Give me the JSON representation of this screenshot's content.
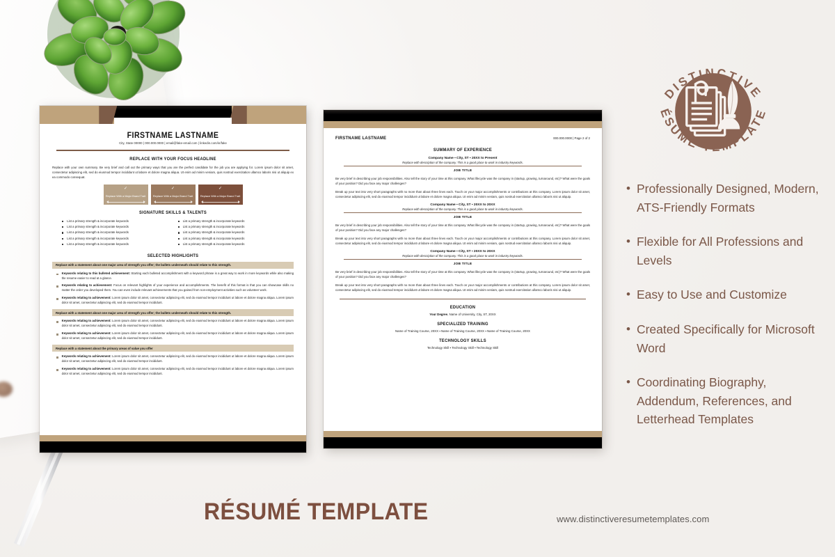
{
  "brand": {
    "logo_top_text": "DISTINCTIVE",
    "logo_bottom_text": "RÉSUMÉ TEMPLATES",
    "accent_brown": "#7d5c48",
    "accent_tan": "#bfa37c",
    "title_color": "#7d4f3f"
  },
  "footer": {
    "title": "RÉSUMÉ TEMPLATE",
    "website": "www.distinctiveresumetemplates.com"
  },
  "features": {
    "bullet": "•",
    "items": [
      "Professionally Designed, Modern, ATS-Friendly Formats",
      "Flexible for All Professions and Levels",
      "Easy to Use and Customize",
      "Created Specifically for Microsoft Word",
      "Coordinating Biography, Addendum, References, and Letterhead Templates"
    ]
  },
  "page1": {
    "name": "FIRSTNAME LASTNAME",
    "contact": "City, State 00000 | 000.000.0000 | email@fake-email.com | linkedin.com/in/fake",
    "headline": "REPLACE WITH YOUR FOCUS HEADLINE",
    "summary": "Replace with your own summary. Be very brief and call out the primary ways that you are the perfect candidate for the job you are applying for.  Lorem ipsum dolor sit amet, consectetur adipiscing elit, sed do eiusmod tempor incididunt ut labore et dolore magna aliqua. Ut enim ad minim veniam, quis nostrud exercitation ullamco laboris nisi ut aliquip ex ea commodo consequat.",
    "traits": [
      {
        "label": "Replace With a Major Brand Trait",
        "color": "#b6a186",
        "check": "✓"
      },
      {
        "label": "Replace With a Major Brand Trait",
        "color": "#9b7a5f",
        "check": "✓"
      },
      {
        "label": "Replace With a Major Brand Trait",
        "color": "#7d4f3b",
        "check": "✓"
      }
    ],
    "skills_title": "SIGNATURE SKILLS & TALENTS",
    "skills_left": [
      "List a primary strength & incorporate keywords",
      "List a primary strength & incorporate keywords",
      "List a primary strength & incorporate keywords",
      "List a primary strength & incorporate keywords",
      "List a primary strength & incorporate keywords"
    ],
    "skills_right": [
      "List a primary strength & incorporate keywords",
      "List a primary strength & incorporate keywords",
      "List a primary strength & incorporate keywords",
      "List a primary strength & incorporate keywords",
      "List a primary strength & incorporate keywords"
    ],
    "highlights_title": "SELECTED HIGHLIGHTS",
    "highlight_groups": [
      {
        "bar": "Replace with a statement about one major area of strength you offer; the bullets underneath should relate to this strength.",
        "items": [
          {
            "lead": "Keywords relating to this bulleted achievement:",
            "text": " Starting each bulleted accomplishment with a keyword phrase is a great way to work in more keywords while also making the resume easier to read at a glance."
          },
          {
            "lead": "Keywords relating to achievement:",
            "text": " Focus on relevant highlights of your experience and accomplishments. The benefit of this format is that you can showcase skills no matter the order you developed them. You can even include relevant achievements that you gained from non-employment activities such as volunteer work."
          },
          {
            "lead": "Keywords relating to achievement:",
            "text": " Lorem ipsum dolor sit amet, consectetur adipiscing elit, sed do eiusmod tempor incididunt ut labore et dolore magna aliqua. Lorem ipsum dolor sit amet, consectetur adipiscing elit, sed do eiusmod tempor incididunt."
          }
        ]
      },
      {
        "bar": "Replace with a statement about one major area of strength you offer; the bullets underneath should relate to this strength.",
        "items": [
          {
            "lead": "Keywords relating to achievement:",
            "text": " Lorem ipsum dolor sit amet, consectetur adipiscing elit, sed do eiusmod tempor incididunt ut labore et dolore magna aliqua. Lorem ipsum dolor sit amet, consectetur adipiscing elit, sed do eiusmod tempor incididunt."
          },
          {
            "lead": "Keywords relating to achievement:",
            "text": " Lorem ipsum dolor sit amet, consectetur adipiscing elit, sed do eiusmod tempor incididunt ut labore et dolore magna aliqua. Lorem ipsum dolor sit amet, consectetur adipiscing elit, sed do eiusmod tempor incididunt."
          }
        ]
      },
      {
        "bar": "Replace with a statement about the primary areas of value you offer",
        "items": [
          {
            "lead": "Keywords relating to achievement:",
            "text": " Lorem ipsum dolor sit amet, consectetur adipiscing elit, sed do eiusmod tempor incididunt ut labore et dolore magna aliqua. Lorem ipsum dolor sit amet, consectetur adipiscing elit, sed do eiusmod tempor incididunt."
          },
          {
            "lead": "Keywords relating to achievement:",
            "text": " Lorem ipsum dolor sit amet, consectetur adipiscing elit, sed do eiusmod tempor incididunt ut labore et dolore magna aliqua. Lorem ipsum dolor sit amet, consectetur adipiscing elit, sed do eiusmod tempor incididunt."
          }
        ]
      }
    ]
  },
  "page2": {
    "name": "FIRSTNAME LASTNAME",
    "page_info": "000.000.0000 | Page 2 of 2",
    "summary_title": "SUMMARY OF EXPERIENCE",
    "jobs": [
      {
        "company": "Company Name ▪ City, ST ▪ 20XX to Present",
        "company_desc": "Replace with description of the company. This is a good place to work in industry keywords.",
        "title": "JOB TITLE",
        "p1": "Be very brief in describing your job responsibilities. Also tell the story of your time at this company. What lifecycle was the company in (startup, growing, turnaround, etc)? What were the goals of your position? Did you face any major challenges?",
        "p2": "Break up your text into very short paragraphs with no more than about three lines each. Touch on your major accomplishments or contributions at this company. Lorem ipsum dolor sit amet, consectetur adipiscing elit, sed do eiusmod tempor incididunt ut labore et dolore magna aliqua. Ut enim ad minim veniam, quis nostrud exercitation ullamco laboris nisi ut aliquip."
      },
      {
        "company": "Company Name ▪ City, ST ▪ 20XX to 20XX",
        "company_desc": "Replace with description of the company. This is a good place to work in industry keywords.",
        "title": "JOB TITLE",
        "p1": "Be very brief in describing your job responsibilities. Also tell the story of your time at this company. What lifecycle was the company in (startup, growing, turnaround, etc)? What were the goals of your position? Did you face any major challenges?",
        "p2": "Break up your text into very short paragraphs with no more than about three lines each. Touch on your major accomplishments or contributions at this company. Lorem ipsum dolor sit amet, consectetur adipiscing elit, sed do eiusmod tempor incididunt ut labore et dolore magna aliqua. Ut enim ad minim veniam, quis nostrud exercitation ullamco laboris nisi ut aliquip."
      },
      {
        "company": "Company Name ▪ City, ST ▪ 20XX to 20XX",
        "company_desc": "Replace with description of the company. This is a good place to work in industry keywords.",
        "title": "JOB TITLE",
        "p1": "Be very brief in describing your job responsibilities. Also tell the story of your time at this company. What lifecycle was the company in (startup, growing, turnaround, etc)? What were the goals of your position? Did you face any major challenges?",
        "p2": "Break up your text into very short paragraphs with no more than about three lines each. Touch on your major accomplishments or contributions at this company. Lorem ipsum dolor sit amet, consectetur adipiscing elit, sed do eiusmod tempor incididunt ut labore et dolore magna aliqua. Ut enim ad minim veniam, quis nostrud exercitation ullamco laboris nisi ut aliquip."
      }
    ],
    "education_title": "EDUCATION",
    "education_degree_lead": "Your Degree",
    "education_line": ", Name of University, City, ST, 20XX",
    "training_title": "SPECIALIZED TRAINING",
    "training_line": "Name of Training Course, 20XX  ▪ Name of Training Course, 20XX  ▪ Name of Training Course, 20XX",
    "tech_title": "TECHNOLOGY SKILLS",
    "tech_line": "Technology Skill ▪ Technology Skill ▪ Technology Skill"
  }
}
